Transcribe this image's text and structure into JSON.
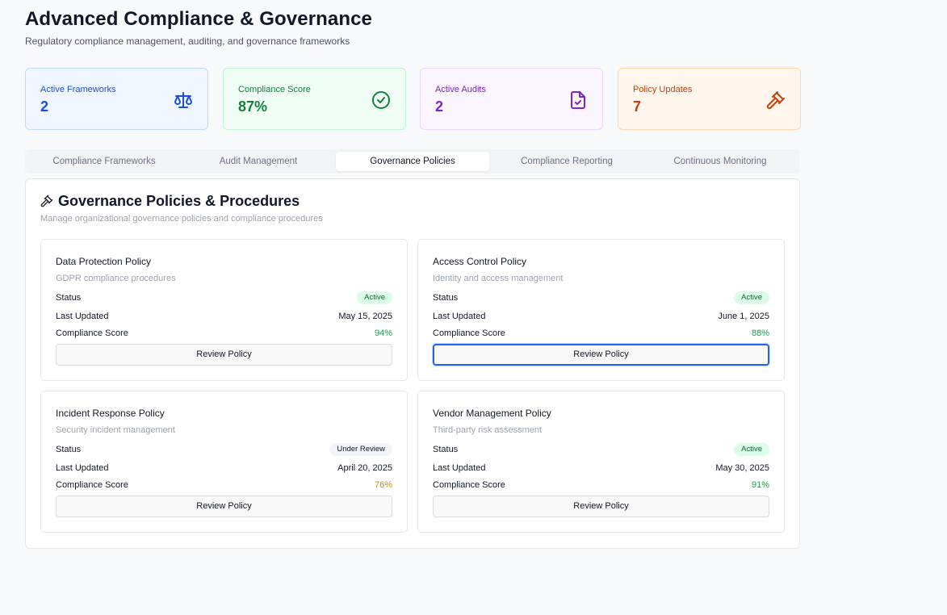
{
  "header": {
    "title": "Advanced Compliance & Governance",
    "subtitle": "Regulatory compliance management, auditing, and governance frameworks"
  },
  "stats": [
    {
      "label": "Active Frameworks",
      "value": "2",
      "icon": "scale-icon",
      "color": "#1d4ed8",
      "bg": "#eff6ff",
      "border": "#bfdbfe"
    },
    {
      "label": "Compliance Score",
      "value": "87%",
      "icon": "check-circle-icon",
      "color": "#15803d",
      "bg": "#f0fdf4",
      "border": "#bbf7d0"
    },
    {
      "label": "Active Audits",
      "value": "2",
      "icon": "file-check-icon",
      "color": "#7e22ce",
      "bg": "#faf5ff",
      "border": "#e9d5ff"
    },
    {
      "label": "Policy Updates",
      "value": "7",
      "icon": "gavel-icon",
      "color": "#c2410c",
      "bg": "#fff7ed",
      "border": "#fed7aa"
    }
  ],
  "tabs": [
    {
      "label": "Compliance Frameworks",
      "active": false
    },
    {
      "label": "Audit Management",
      "active": false
    },
    {
      "label": "Governance Policies",
      "active": true
    },
    {
      "label": "Compliance Reporting",
      "active": false
    },
    {
      "label": "Continuous Monitoring",
      "active": false
    }
  ],
  "panel": {
    "title": "Governance Policies & Procedures",
    "subtitle": "Manage organizational governance policies and compliance procedures",
    "icon": "gavel-icon"
  },
  "labels": {
    "status": "Status",
    "last_updated": "Last Updated",
    "compliance_score": "Compliance Score",
    "review_button": "Review Policy"
  },
  "policies": [
    {
      "title": "Data Protection Policy",
      "description": "GDPR compliance procedures",
      "status": "Active",
      "last_updated": "May 15, 2025",
      "score": "94%",
      "score_color": "#16a34a"
    },
    {
      "title": "Access Control Policy",
      "description": "Identity and access management",
      "status": "Active",
      "last_updated": "June 1, 2025",
      "score": "88%",
      "score_color": "#16a34a"
    },
    {
      "title": "Incident Response Policy",
      "description": "Security incident management",
      "status": "Under Review",
      "last_updated": "April 20, 2025",
      "score": "76%",
      "score_color": "#ca8a04"
    },
    {
      "title": "Vendor Management Policy",
      "description": "Third-party risk assessment",
      "status": "Active",
      "last_updated": "May 30, 2025",
      "score": "91%",
      "score_color": "#16a34a"
    }
  ],
  "focused_policy_index": 1
}
